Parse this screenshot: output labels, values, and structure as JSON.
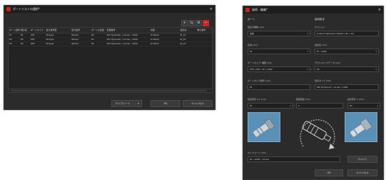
{
  "left_dialog": {
    "title": "ポートリストの選択*",
    "toolbar": {
      "add": "+",
      "copy": "⇆",
      "remove": "−"
    },
    "columns": [
      "ポート番号",
      "端子名",
      "ポートタイプ",
      "最大信号型",
      "最大信号",
      "ポートの位置",
      "管理番号",
      "内容",
      "接続先",
      "端子番号"
    ],
    "rows": [
      [
        "P1",
        "P1",
        "STE",
        "Strtype",
        "Strtem",
        "Wi",
        "POI Hydraulic / 14 bar / 1000",
        "PI 09/21",
        "PI_01",
        ""
      ],
      [
        "P2",
        "P2",
        "STE",
        "Strtype",
        "Strtem",
        "Wi",
        "POI Hydraulic / 14 bar / 1000",
        "PI 09/21",
        "PI_02",
        ""
      ],
      [
        "P3",
        "P3",
        "STE",
        "Strtype",
        "Strtem",
        "Wi",
        "POI Hydraulic / 14 bar / 1000",
        "PI 09/21",
        "PI_03",
        ""
      ]
    ],
    "buttons": {
      "save": "テンプレート",
      "dropdown": "▾",
      "ok": "OK",
      "cancel": "キャンセル"
    }
  },
  "right_dialog": {
    "title": "接続 - 編集*",
    "port_section": "ポート",
    "connect_section": "接続設定",
    "left_fields": [
      {
        "label": "接続の種類 (1/1)",
        "value": "全体"
      },
      {
        "label": "名前 (1/1)",
        "value": "P1"
      },
      {
        "label": "ポートタイプ: 種類 (1/1)",
        "value": "STE / 000 / 10 / 1000"
      },
      {
        "label": "ポートタイプ番号 (1/1)",
        "value": "P1"
      }
    ],
    "right_fields": [
      {
        "label": "オプション",
        "value": "Custom Hydraulic Switch / 8x / 1/2"
      },
      {
        "label": "接続名 (1/1)",
        "value": "Hi / 1000"
      },
      {
        "label": "モデルタイプ/データ (1/1)",
        "value": "Wi"
      },
      {
        "label": "接続タイプ (1/1)",
        "value": "POI Hydraulic / 14 bar / 1000"
      }
    ],
    "preview_labels": {
      "left": "接続形状 1/1 (1/1)",
      "mid": "回転角度 (1/1)",
      "right": "接続形状 2 (1/1)"
    },
    "preview_values": {
      "left": "P1",
      "mid": "0",
      "right": "P2"
    },
    "type_code": {
      "label": "タイプコード (1/1)",
      "value": "P1 / 1000 / 14 bar",
      "right": "コメント"
    },
    "buttons": {
      "ok": "OK",
      "cancel": "キャンセル"
    }
  }
}
